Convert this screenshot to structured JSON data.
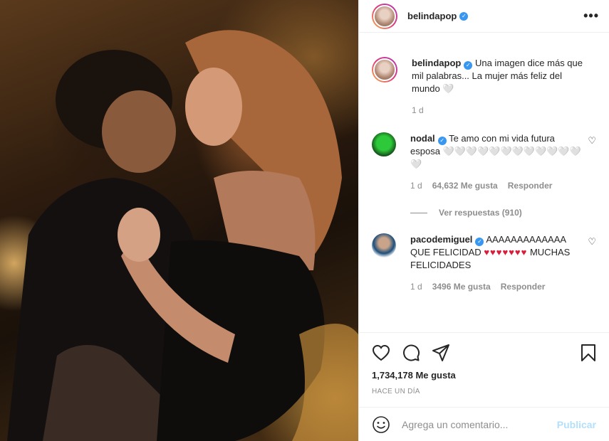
{
  "header": {
    "username": "belindapop",
    "more_label": "•••"
  },
  "caption": {
    "username": "belindapop",
    "text": "Una imagen dice más que mil palabras... La mujer más feliz del mundo 🤍",
    "time": "1 d"
  },
  "comments": [
    {
      "username": "nodal",
      "text": "Te amo con mi vida futura esposa 🤍🤍🤍🤍🤍🤍🤍🤍🤍🤍🤍🤍🤍",
      "time": "1 d",
      "likes": "64,632 Me gusta",
      "reply": "Responder",
      "view_replies": "Ver respuestas (910)"
    },
    {
      "username": "pacodemiguel",
      "text_before": "AAAAAAAAAAAAA QUE FELICIDAD",
      "hearts": "♥♥♥♥♥♥♥",
      "text_after": "MUCHAS FELICIDADES",
      "time": "1 d",
      "likes": "3496 Me gusta",
      "reply": "Responder"
    }
  ],
  "post": {
    "likes": "1,734,178 Me gusta",
    "timestamp": "HACE UN DÍA"
  },
  "add_comment": {
    "placeholder": "Agrega un comentario...",
    "publish_label": "Publicar"
  },
  "colors": {
    "verified": "#3897f0",
    "secondary_text": "#8e8e8e",
    "hearts": "#d71f3b",
    "publish": "#b2dffc"
  }
}
